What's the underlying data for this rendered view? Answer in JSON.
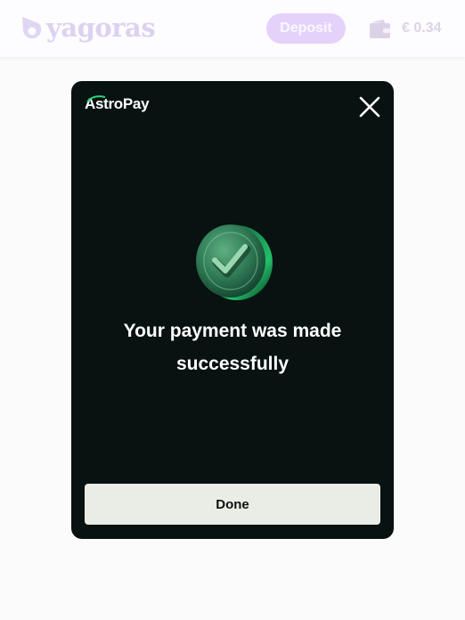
{
  "header": {
    "logo_text": "yagoras",
    "deposit_label": "Deposit",
    "balance": "€ 0.34",
    "wallet_icon": "wallet-icon"
  },
  "modal": {
    "brand": "AstroPay",
    "close_icon": "close-icon",
    "status_icon": "check-coin-icon",
    "message": "Your payment was made successfully",
    "done_label": "Done"
  },
  "colors": {
    "accent": "#e5d2fb",
    "modal_bg": "#071211",
    "success_green": "#2fa362",
    "done_bg": "#eaede6"
  }
}
